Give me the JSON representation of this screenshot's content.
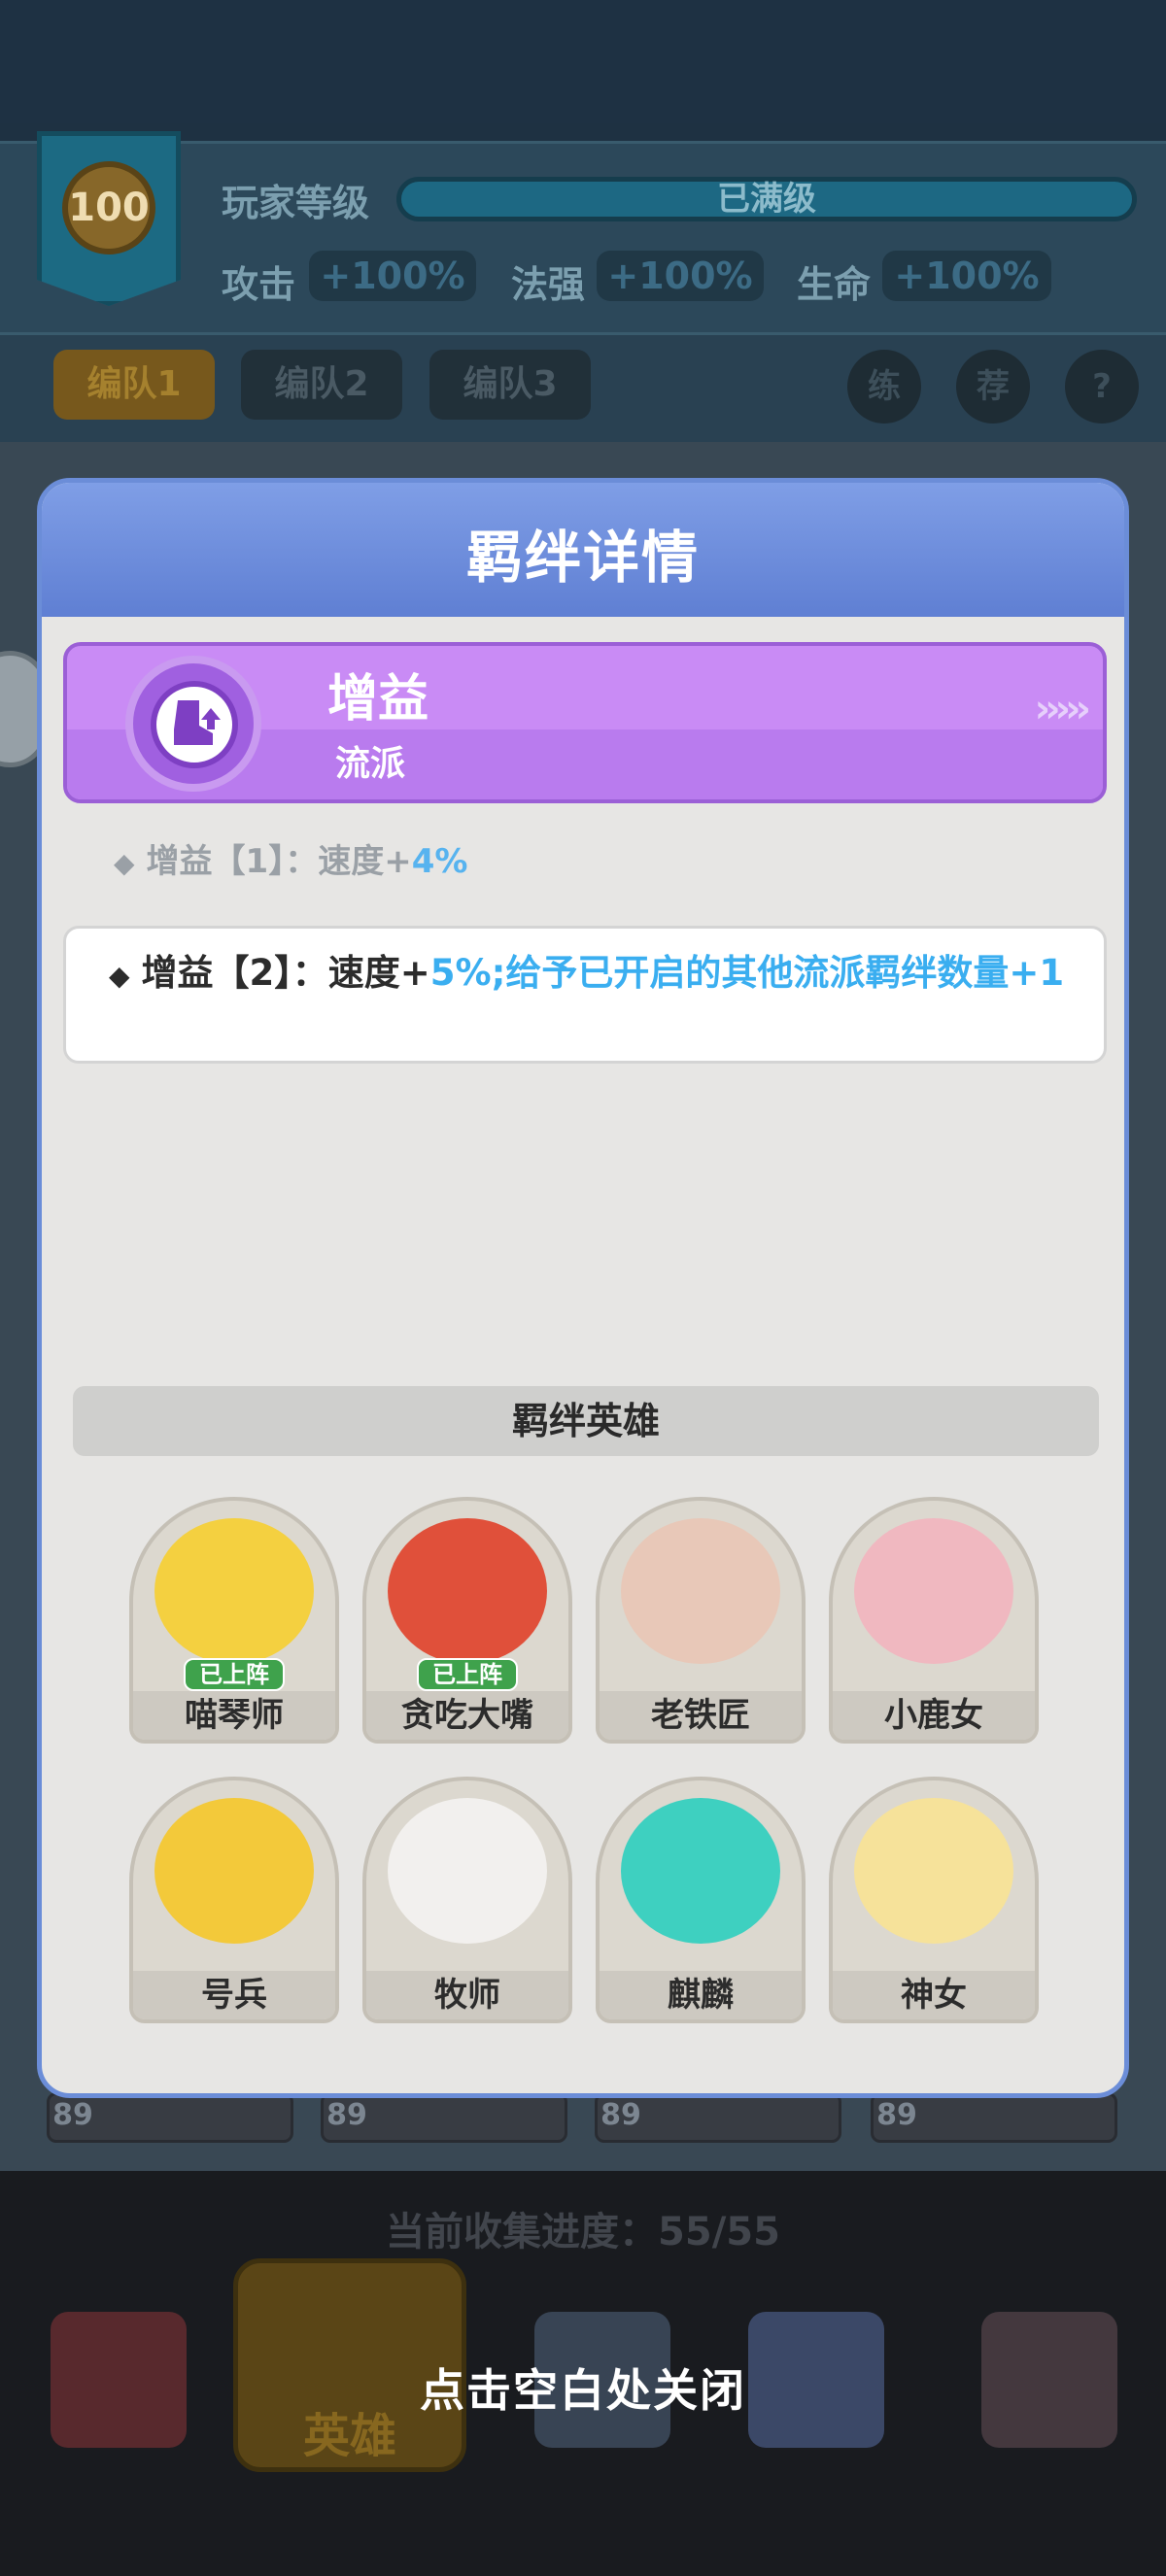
{
  "background": {
    "player_level": "100",
    "level_label": "玩家等级",
    "level_status": "已满级",
    "stats": [
      {
        "label": "攻击",
        "value": "+100%"
      },
      {
        "label": "法强",
        "value": "+100%"
      },
      {
        "label": "生命",
        "value": "+100%"
      }
    ],
    "teams": [
      "编队1",
      "编队2",
      "编队3"
    ],
    "round_buttons": [
      "练",
      "荐",
      "?"
    ],
    "hero_levels": [
      "89",
      "89",
      "89",
      "89"
    ],
    "collection_progress": "当前收集进度：55/55",
    "nav_active_label": "英雄"
  },
  "modal": {
    "title": "羁绊详情",
    "bond": {
      "name": "增益",
      "type": "流派",
      "icon": "boot-up-icon"
    },
    "effects": [
      {
        "prefix": "增益【1】：速度+",
        "highlight": "4%"
      },
      {
        "prefix": "增益【2】：速度+",
        "highlight": "5%;给予已开启的其他流派羁绊数量+1"
      }
    ],
    "heroes_header": "羁绊英雄",
    "heroes": [
      {
        "name": "喵琴师",
        "tag": "已上阵",
        "color": "#f4d040"
      },
      {
        "name": "贪吃大嘴",
        "tag": "已上阵",
        "color": "#e0503a"
      },
      {
        "name": "老铁匠",
        "tag": "",
        "color": "#e8c8b8"
      },
      {
        "name": "小鹿女",
        "tag": "",
        "color": "#f0b8c0"
      },
      {
        "name": "号兵",
        "tag": "",
        "color": "#f3c93a"
      },
      {
        "name": "牧师",
        "tag": "",
        "color": "#f2f0ee"
      },
      {
        "name": "麒麟",
        "tag": "",
        "color": "#3ed0c0"
      },
      {
        "name": "神女",
        "tag": "",
        "color": "#f6e29a"
      }
    ]
  },
  "close_hint": "点击空白处关闭",
  "colors": {
    "header_blue": "#6f8fdc",
    "bond_purple": "#c98bf5",
    "highlight_blue": "#3aaef0",
    "deployed_green": "#3fa24c"
  }
}
